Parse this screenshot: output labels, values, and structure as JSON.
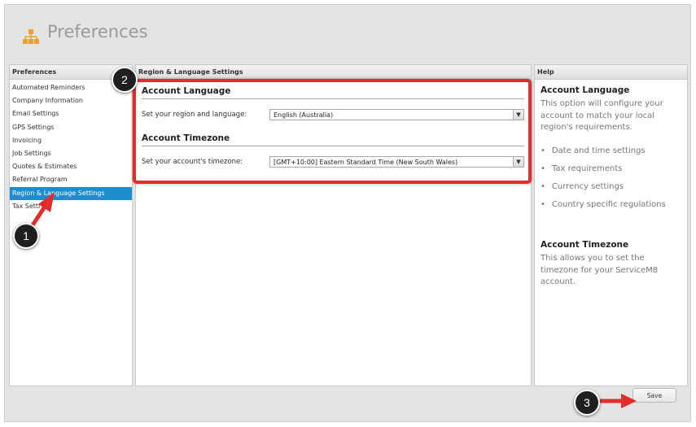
{
  "app": {
    "title": "Preferences"
  },
  "sidebar": {
    "header": "Preferences",
    "items": [
      {
        "label": "Automated Reminders"
      },
      {
        "label": "Company Information"
      },
      {
        "label": "Email Settings"
      },
      {
        "label": "GPS Settings"
      },
      {
        "label": "Invoicing"
      },
      {
        "label": "Job Settings"
      },
      {
        "label": "Quotes & Estimates"
      },
      {
        "label": "Referral Program"
      },
      {
        "label": "Region & Language Settings",
        "active": true
      },
      {
        "label": "Tax Setti"
      }
    ]
  },
  "main": {
    "header": "Region & Language Settings",
    "account_language": {
      "heading": "Account Language",
      "label": "Set your region and language:",
      "value": "English (Australia)"
    },
    "account_timezone": {
      "heading": "Account Timezone",
      "label": "Set your account's timezone:",
      "value": "[GMT+10:00] Eastern Standard Time (New South Wales)"
    }
  },
  "help": {
    "header": "Help",
    "language_heading": "Account Language",
    "language_text": "This option will configure your account to match your local region's requirements.",
    "bullets": [
      "Date and time settings",
      "Tax requirements",
      "Currency settings",
      "Country specific regulations"
    ],
    "timezone_heading": "Account Timezone",
    "timezone_text": "This allows you to set the timezone for your ServiceM8 account."
  },
  "footer": {
    "save_label": "Save"
  },
  "annotations": {
    "step1": "1",
    "step2": "2",
    "step3": "3"
  },
  "colors": {
    "accent": "#1c8ecf",
    "highlight": "#e52b2b",
    "logo": "#f0a030"
  }
}
